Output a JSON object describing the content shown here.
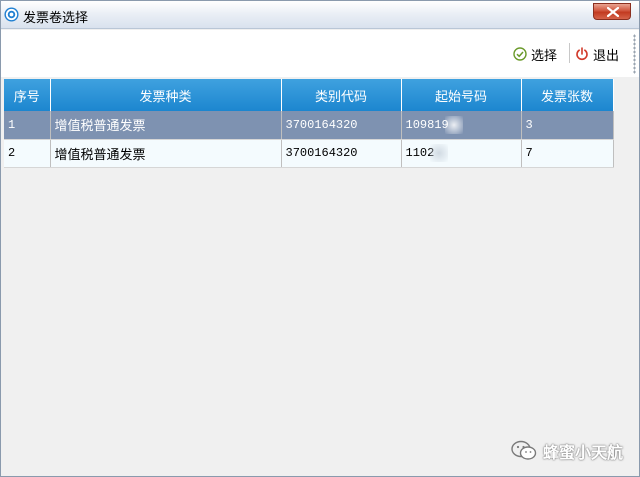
{
  "window": {
    "title": "发票卷选择"
  },
  "toolbar": {
    "select_label": "选择",
    "exit_label": "退出"
  },
  "grid": {
    "columns": [
      "序号",
      "发票种类",
      "类别代码",
      "起始号码",
      "发票张数"
    ],
    "rows": [
      {
        "index": "1",
        "type": "增值税普通发票",
        "code": "3700164320",
        "start": "109819",
        "count": "3",
        "selected": true
      },
      {
        "index": "2",
        "type": "增值税普通发票",
        "code": "3700164320",
        "start": "1102",
        "count": "7",
        "selected": false
      }
    ]
  },
  "watermark": {
    "text": "蜂蜜小天航"
  },
  "colors": {
    "header": "#1c86cf",
    "selected_row": "#7e92b1",
    "close": "#c23a20",
    "select_icon": "#6a9a2a",
    "exit_icon": "#d23a2a"
  }
}
